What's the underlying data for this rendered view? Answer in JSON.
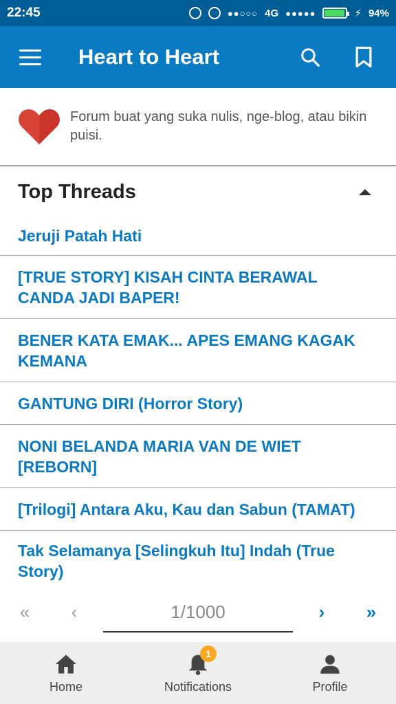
{
  "status_bar": {
    "time": "22:45",
    "network": "4G",
    "battery_level": 0.94,
    "battery_text": "94%"
  },
  "app_bar": {
    "title": "Heart to Heart",
    "icons": [
      "menu-icon",
      "search-icon",
      "bookmark-icon"
    ]
  },
  "forum": {
    "description": "Forum buat yang suka nulis, nge-blog, atau bikin puisi.",
    "icon": "heart-icon"
  },
  "top_threads": {
    "title": "Top Threads",
    "items": [
      "Jeruji Patah Hati",
      "[TRUE STORY] KISAH CINTA BERAWAL CANDA JADI BAPER!",
      "BENER KATA EMAK... APES EMANG KAGAK KEMANA",
      "GANTUNG DIRI (Horror Story)",
      "NONI BELANDA MARIA VAN DE WIET [REBORN]",
      "[Trilogi] Antara Aku, Kau dan Sabun (TAMAT)",
      "Tak Selamanya [Selingkuh Itu] Indah (True Story)"
    ]
  },
  "pagination": {
    "indicator": "1/1000",
    "first": "«",
    "prev": "‹",
    "next": "›",
    "last": "»"
  },
  "bottom_nav": {
    "home_label": "Home",
    "notifications_label": "Notifications",
    "notifications_badge": "1",
    "profile_label": "Profile"
  },
  "colors": {
    "status_bar": "#015d96",
    "app_bar": "#0a7ac2",
    "link": "#0a7ac2",
    "heart": "#e53935",
    "badge": "#f9a825"
  }
}
